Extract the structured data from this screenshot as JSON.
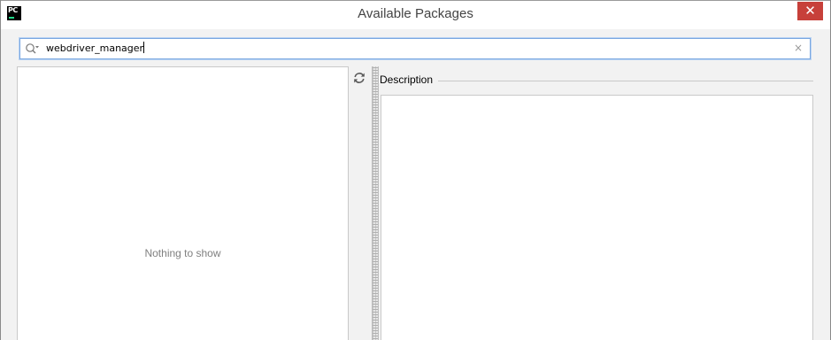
{
  "window": {
    "title": "Available Packages",
    "app_icon_text": "PC",
    "close_symbol": "✕"
  },
  "search": {
    "value": "webdriver_manager",
    "icon": "search-icon",
    "clear_symbol": "×"
  },
  "package_list": {
    "empty_text": "Nothing to show"
  },
  "toolbar": {
    "refresh_icon": "refresh-icon"
  },
  "description": {
    "label": "Description",
    "content": ""
  },
  "colors": {
    "close_button": "#c7403a",
    "search_focus_border": "#7aa7e0",
    "app_icon_accent": "#21d789"
  }
}
